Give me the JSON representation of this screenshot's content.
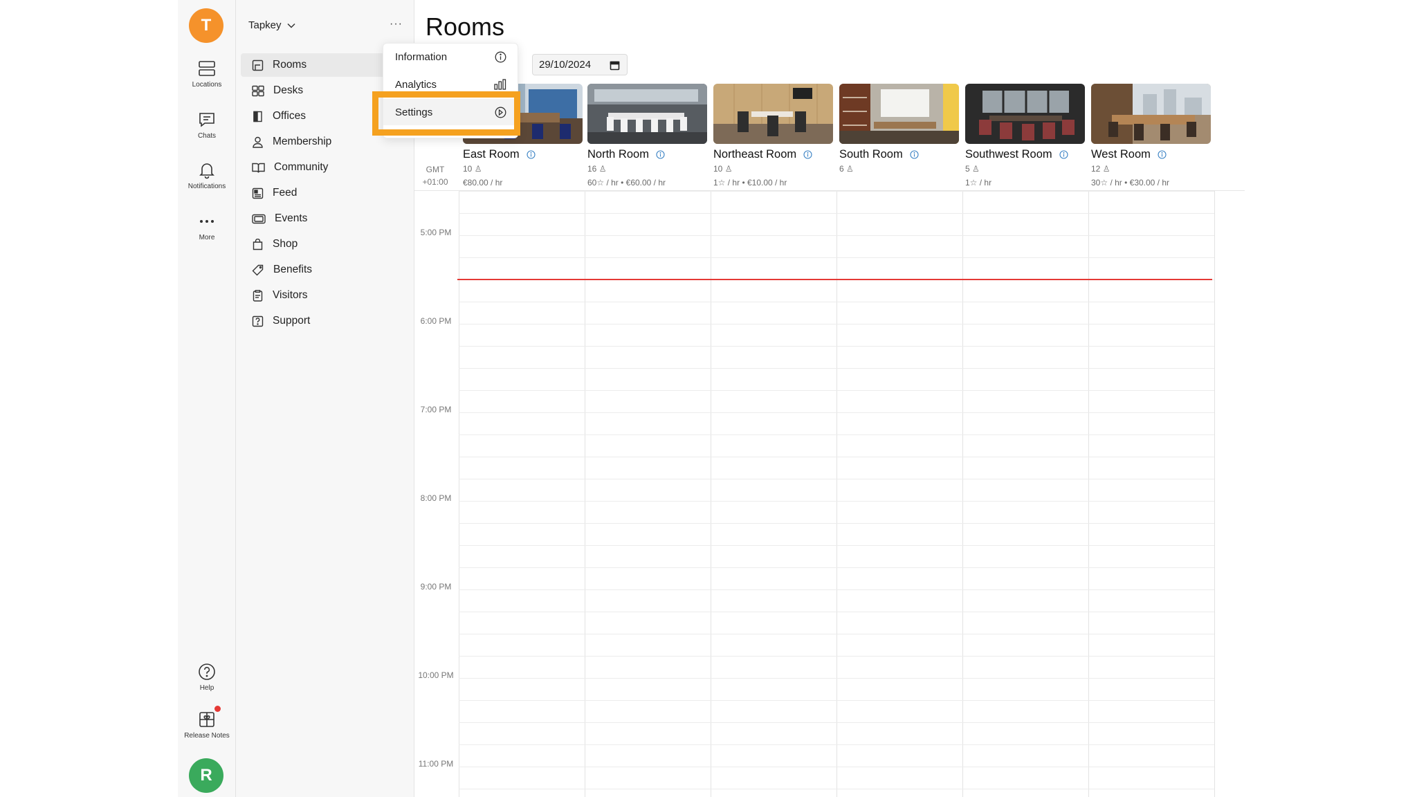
{
  "rail": {
    "workspace_initial": "T",
    "workspace_color": "#f5922b",
    "items": [
      {
        "label": "Locations"
      },
      {
        "label": "Chats"
      },
      {
        "label": "Notifications"
      },
      {
        "label": "More"
      },
      {
        "label": "Help"
      },
      {
        "label": "Release Notes"
      }
    ],
    "user_initial": "R",
    "user_color": "#3aaa5c"
  },
  "nav": {
    "workspace_name": "Tapkey",
    "more": "···",
    "items": [
      {
        "label": "Rooms"
      },
      {
        "label": "Desks"
      },
      {
        "label": "Offices"
      },
      {
        "label": "Membership"
      },
      {
        "label": "Community"
      },
      {
        "label": "Feed"
      },
      {
        "label": "Events"
      },
      {
        "label": "Shop"
      },
      {
        "label": "Benefits"
      },
      {
        "label": "Visitors"
      },
      {
        "label": "Support"
      }
    ]
  },
  "menu": {
    "items": [
      {
        "label": "Information"
      },
      {
        "label": "Analytics"
      },
      {
        "label": "Settings"
      }
    ]
  },
  "main": {
    "title": "Rooms",
    "date": "29/10/2024",
    "timezone": [
      "GMT",
      "+01:00"
    ],
    "rooms": [
      {
        "name": "East Room",
        "capacity": "10",
        "price": "€80.00 / hr"
      },
      {
        "name": "North Room",
        "capacity": "16",
        "price": "60☆ / hr • €60.00 / hr"
      },
      {
        "name": "Northeast Room",
        "capacity": "10",
        "price": "1☆ / hr • €10.00 / hr"
      },
      {
        "name": "South Room",
        "capacity": "6",
        "price": ""
      },
      {
        "name": "Southwest Room",
        "capacity": "5",
        "price": "1☆ / hr"
      },
      {
        "name": "West Room",
        "capacity": "12",
        "price": "30☆ / hr • €30.00 / hr"
      }
    ],
    "times": [
      "5:00 PM",
      "6:00 PM",
      "7:00 PM",
      "8:00 PM",
      "9:00 PM",
      "10:00 PM",
      "11:00 PM"
    ],
    "accent_color": "#e53935",
    "highlight_color": "#f5a11f"
  }
}
